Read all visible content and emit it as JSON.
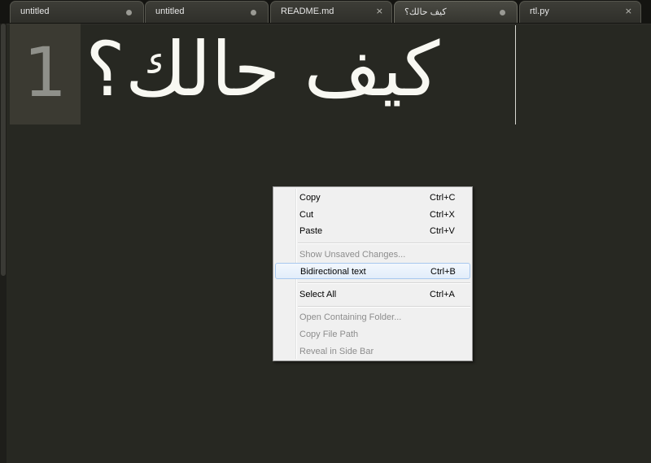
{
  "tabs": [
    {
      "label": "untitled",
      "state": "modified"
    },
    {
      "label": "untitled",
      "state": "modified"
    },
    {
      "label": "README.md",
      "state": "close"
    },
    {
      "label": "كيف حالك؟",
      "state": "modified"
    },
    {
      "label": "rtl.py",
      "state": "close"
    }
  ],
  "icons": {
    "modified": "dot-icon",
    "close": "×"
  },
  "editor": {
    "line_number": "1",
    "line_text": "كيف حالك؟"
  },
  "context_menu": {
    "items": [
      {
        "label": "Copy",
        "shortcut": "Ctrl+C",
        "enabled": true
      },
      {
        "label": "Cut",
        "shortcut": "Ctrl+X",
        "enabled": true
      },
      {
        "label": "Paste",
        "shortcut": "Ctrl+V",
        "enabled": true
      },
      {
        "label": "Show Unsaved Changes...",
        "shortcut": "",
        "enabled": false
      },
      {
        "label": "Bidirectional text",
        "shortcut": "Ctrl+B",
        "enabled": true,
        "highlighted": true
      },
      {
        "label": "Select All",
        "shortcut": "Ctrl+A",
        "enabled": true
      },
      {
        "label": "Open Containing Folder...",
        "shortcut": "",
        "enabled": false
      },
      {
        "label": "Copy File Path",
        "shortcut": "",
        "enabled": false
      },
      {
        "label": "Reveal in Side Bar",
        "shortcut": "",
        "enabled": false
      }
    ]
  },
  "colors": {
    "editor_background": "#272822",
    "text": "#f8f8f2",
    "gutter_highlight": "#3b3a32",
    "menu_background": "#f0f0f0",
    "menu_highlight_border": "#a8c8ee"
  }
}
